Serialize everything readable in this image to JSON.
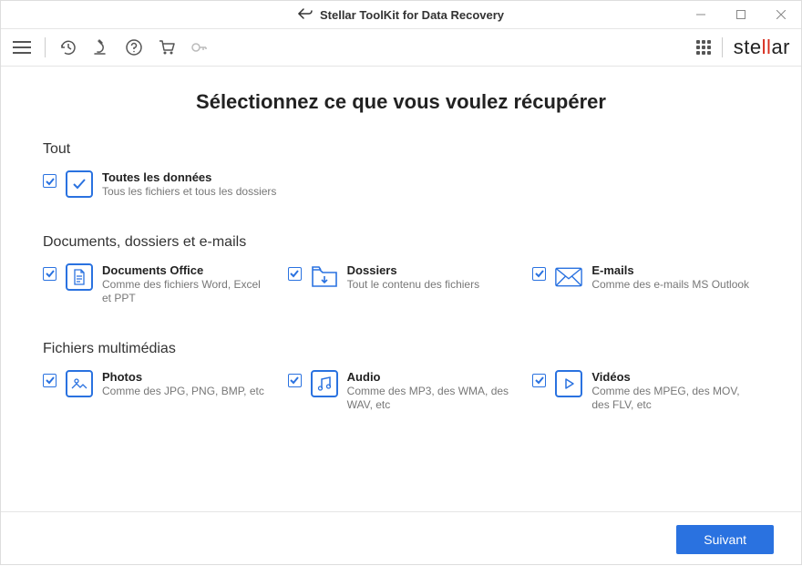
{
  "window": {
    "title": "Stellar ToolKit for Data Recovery"
  },
  "brand": {
    "prefix": "ste",
    "accent": "ll",
    "suffix": "ar"
  },
  "main": {
    "title": "Sélectionnez ce que vous voulez récupérer"
  },
  "sections": {
    "all": {
      "heading": "Tout",
      "item": {
        "title": "Toutes les données",
        "desc": "Tous les fichiers et tous les dossiers"
      }
    },
    "docs": {
      "heading": "Documents, dossiers et e-mails",
      "office": {
        "title": "Documents Office",
        "desc": "Comme des fichiers Word, Excel et PPT"
      },
      "folders": {
        "title": "Dossiers",
        "desc": "Tout le contenu des fichiers"
      },
      "emails": {
        "title": "E-mails",
        "desc": "Comme des e-mails MS Outlook"
      }
    },
    "media": {
      "heading": "Fichiers multimédias",
      "photos": {
        "title": "Photos",
        "desc": "Comme des JPG, PNG, BMP, etc"
      },
      "audio": {
        "title": "Audio",
        "desc": "Comme des MP3, des WMA, des WAV, etc"
      },
      "videos": {
        "title": "Vidéos",
        "desc": "Comme des MPEG, des MOV, des FLV, etc"
      }
    }
  },
  "footer": {
    "next": "Suivant"
  }
}
